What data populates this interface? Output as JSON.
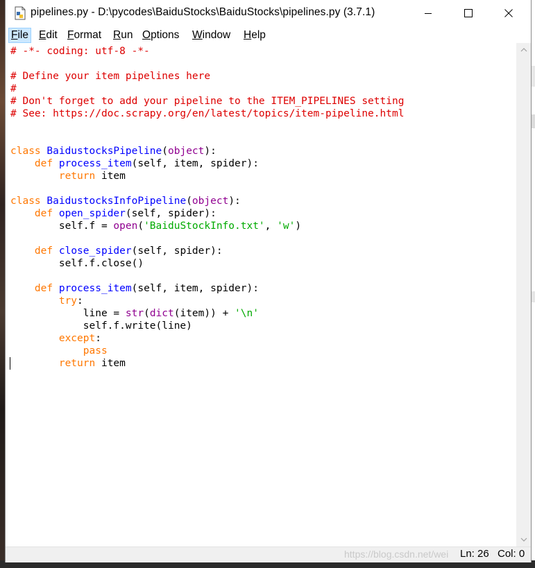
{
  "window": {
    "title": "pipelines.py - D:\\pycodes\\BaiduStocks\\BaiduStocks\\pipelines.py (3.7.1)",
    "app_icon": "python-file-icon",
    "controls": {
      "minimize": "minimize-icon",
      "maximize": "maximize-icon",
      "close": "close-icon"
    }
  },
  "menubar": {
    "items": [
      {
        "label": "File",
        "ul": "F",
        "rest": "ile"
      },
      {
        "label": "Edit",
        "ul": "E",
        "rest": "dit"
      },
      {
        "label": "Format",
        "ul": "F",
        "rest": "ormat"
      },
      {
        "label": "Run",
        "ul": "R",
        "rest": "un"
      },
      {
        "label": "Options",
        "ul": "O",
        "rest": "ptions"
      },
      {
        "label": "Window",
        "ul": "W",
        "rest": "indow"
      },
      {
        "label": "Help",
        "ul": "H",
        "rest": "elp"
      }
    ]
  },
  "code": {
    "lines": [
      "# -*- coding: utf-8 -*-",
      "",
      "# Define your item pipelines here",
      "#",
      "# Don't forget to add your pipeline to the ITEM_PIPELINES setting",
      "# See: https://doc.scrapy.org/en/latest/topics/item-pipeline.html",
      "",
      "",
      "class BaidustocksPipeline(object):",
      "    def process_item(self, item, spider):",
      "        return item",
      "",
      "class BaidustocksInfoPipeline(object):",
      "    def open_spider(self, spider):",
      "        self.f = open('BaiduStockInfo.txt', 'w')",
      "",
      "    def close_spider(self, spider):",
      "        self.f.close()",
      "",
      "    def process_item(self, item, spider):",
      "        try:",
      "            line = str(dict(item)) + '\\n'",
      "            self.f.write(line)",
      "        except:",
      "            pass",
      "        return item"
    ],
    "colors": {
      "keyword": "#ff7700",
      "comment": "#dd0000",
      "string": "#00aa00",
      "builtin": "#900090",
      "definition": "#0000ff"
    }
  },
  "statusbar": {
    "watermark": "https://blog.csdn.net/wei",
    "ln": "Ln: 26",
    "col": "Col: 0"
  }
}
